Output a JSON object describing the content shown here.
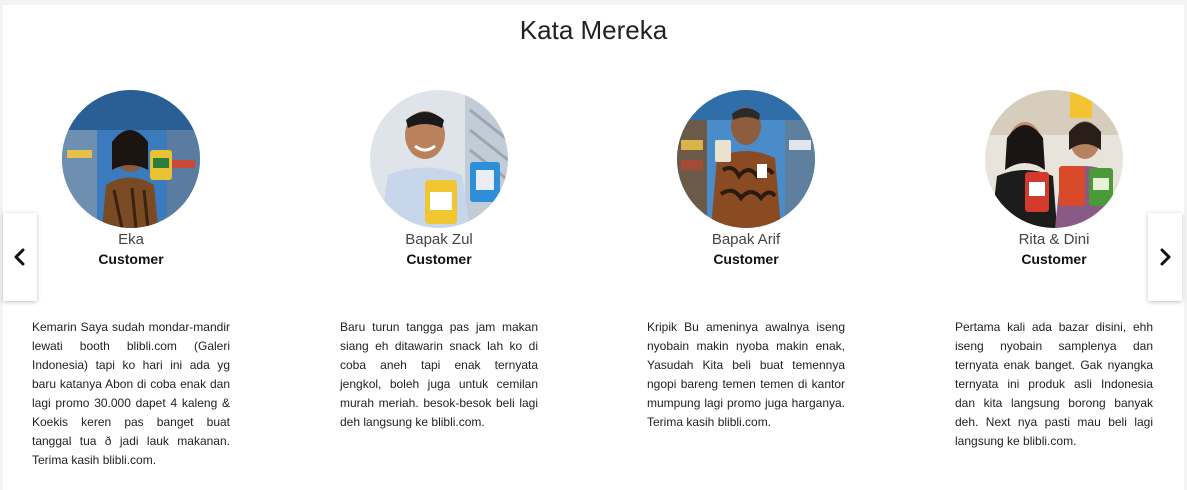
{
  "section": {
    "title": "Kata Mereka"
  },
  "testimonials": [
    {
      "name": "Eka",
      "role": "Customer",
      "quote": "Kemarin Saya sudah mondar-mandir lewati booth blibli.com (Galeri Indonesia) tapi ko hari ini ada yg baru katanya Abon di coba enak dan lagi promo 30.000 dapet 4 kaleng & Koekis keren pas banget buat tanggal tua ð jadi lauk makanan. Terima kasih blibli.com.",
      "photo": "customer-photo"
    },
    {
      "name": "Bapak Zul",
      "role": "Customer",
      "quote": "Baru turun tangga pas jam makan siang eh ditawarin snack lah ko di coba aneh tapi enak ternyata jengkol, boleh juga untuk cemilan murah meriah. besok-besok beli lagi deh langsung ke blibli.com.",
      "photo": "customer-photo"
    },
    {
      "name": "Bapak Arif",
      "role": "Customer",
      "quote": "Kripik Bu ameninya awalnya iseng nyobain makin nyoba makin enak, Yasudah Kita beli buat temennya ngopi bareng temen temen di kantor mumpung lagi promo juga harganya. Terima kasih blibli.com.",
      "photo": "customer-photo"
    },
    {
      "name": "Rita & Dini",
      "role": "Customer",
      "quote": "Pertama kali ada bazar disini, ehh iseng nyobain samplenya dan ternyata enak banget. Gak nyangka ternyata ini produk asli Indonesia dan kita langsung borong banyak deh. Next nya pasti mau beli lagi langsung ke blibli.com.",
      "photo": "customer-photo"
    }
  ],
  "navigation": {
    "prev_icon": "chevron-left-icon",
    "next_icon": "chevron-right-icon"
  },
  "colors": {
    "background": "#f3f3f3",
    "panel": "#ffffff",
    "text": "#222222"
  }
}
